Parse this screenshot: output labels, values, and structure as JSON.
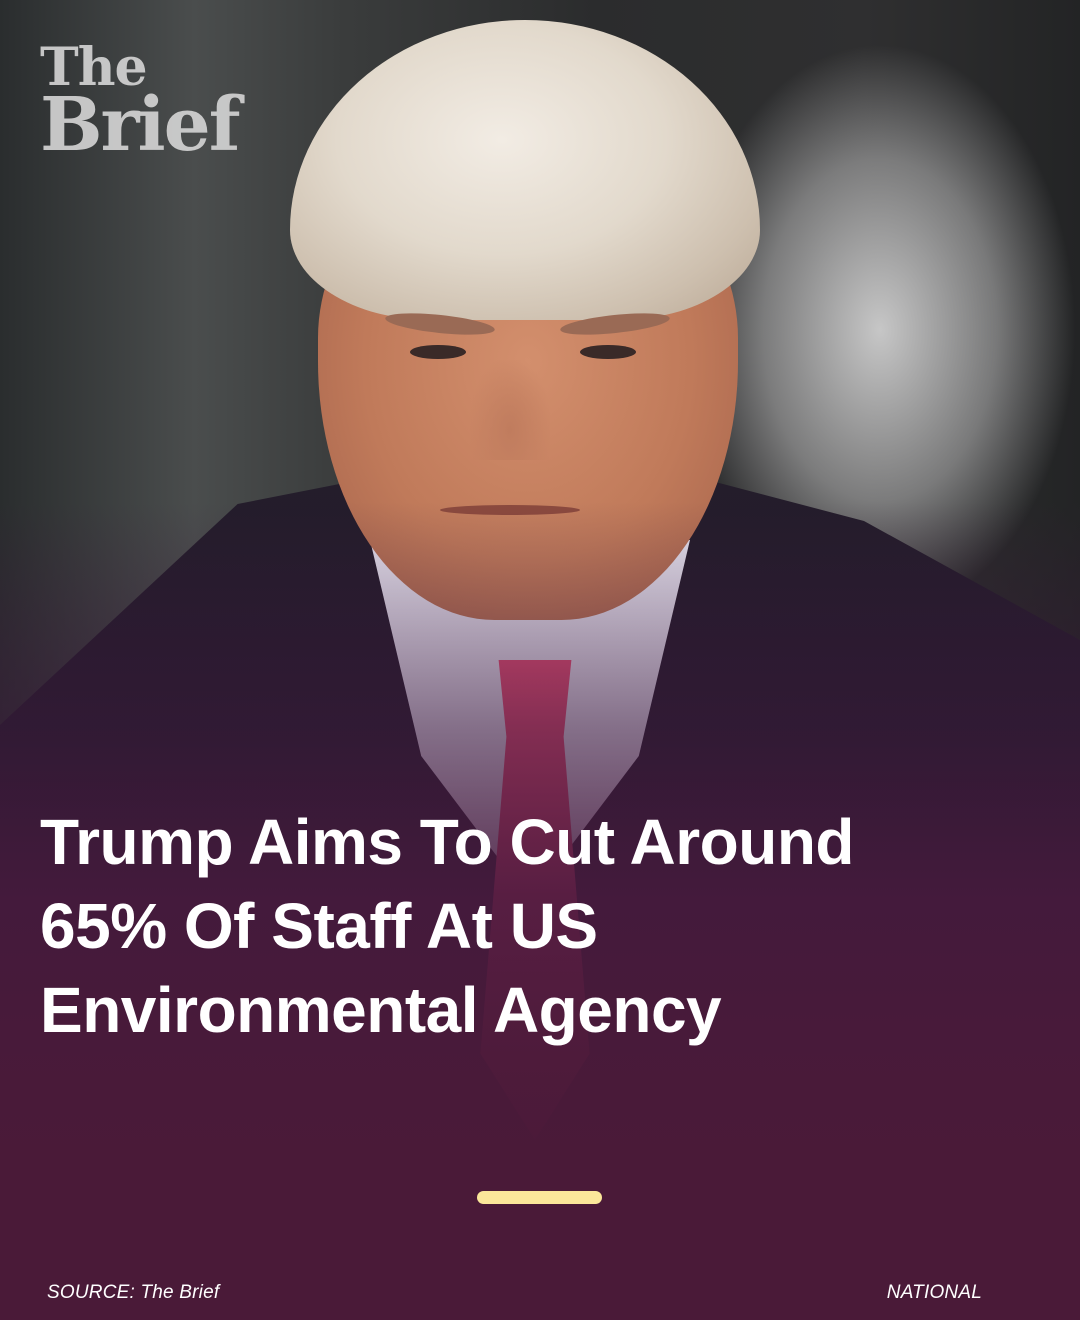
{
  "brand": {
    "logo_line1": "The",
    "logo_line2": "Brief"
  },
  "headline": {
    "line1": "Trump Aims To Cut Around",
    "line2": "65% Of Staff At US",
    "line3": "Environmental Agency"
  },
  "footer": {
    "source": "SOURCE: The Brief",
    "category": "NATIONAL"
  },
  "colors": {
    "background": "#4a1a38",
    "accent_bar": "#fbe79a",
    "text": "#ffffff"
  }
}
